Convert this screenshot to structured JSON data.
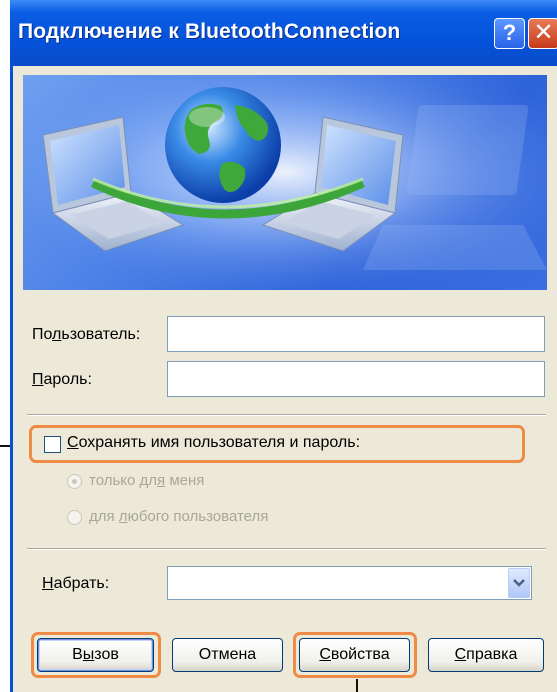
{
  "dialog": {
    "title": "Подключение к BluetoothConnection",
    "help_glyph": "?",
    "close_glyph": "✕"
  },
  "form": {
    "user_label_pre": "По",
    "user_label_u": "л",
    "user_label_post": "ьзователь:",
    "user_value": "",
    "password_label_u": "П",
    "password_label_post": "ароль:",
    "password_value": "",
    "save_label_u": "С",
    "save_label_post": "охранять имя пользователя и пароль:",
    "radio_me_pre": "только дл",
    "radio_me_u": "я",
    "radio_me_post": " меня",
    "radio_any_pre": "для ",
    "radio_any_u": "л",
    "radio_any_post": "юбого пользователя",
    "dial_label_u": "Н",
    "dial_label_post": "абрать:",
    "dial_value": ""
  },
  "buttons": {
    "call_pre": "В",
    "call_u": "ы",
    "call_post": "зов",
    "cancel": "Отмена",
    "properties_u": "С",
    "properties_post": "войства",
    "help_u": "С",
    "help_post": "правка"
  },
  "colors": {
    "titlebar": "#0553db",
    "highlight": "#ef8b46",
    "dialog_bg": "#ece9d8"
  }
}
